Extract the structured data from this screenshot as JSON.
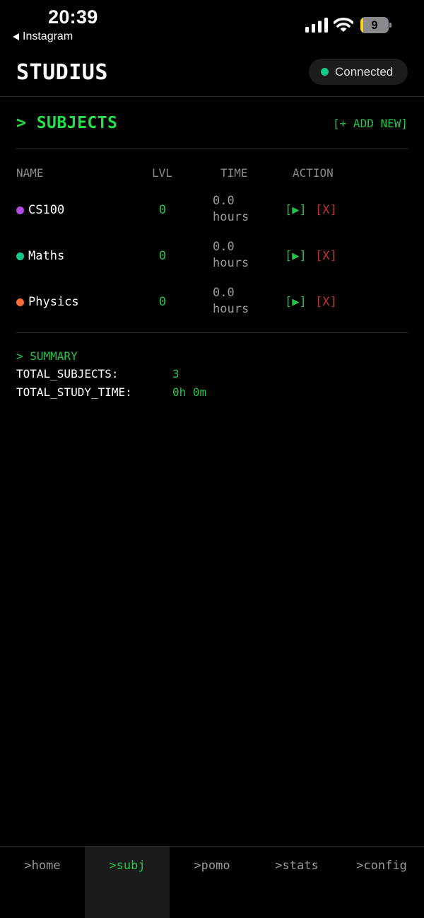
{
  "status_bar": {
    "time": "20:39",
    "back_label": "Instagram",
    "battery_level": "9",
    "battery_percent": 9
  },
  "header": {
    "title": "STUDIUS",
    "connection_label": "Connected",
    "connection_color": "#12c985"
  },
  "section": {
    "title": "> SUBJECTS",
    "add_new_label": "[+ ADD NEW]"
  },
  "table": {
    "columns": [
      "NAME",
      "LVL",
      "TIME",
      "ACTION"
    ],
    "rows": [
      {
        "name": "CS100",
        "color": "#b44be6",
        "level": "0",
        "time_value": "0.0",
        "time_unit": "hours",
        "play_label": "[▶]",
        "delete_label": "[X]"
      },
      {
        "name": "Maths",
        "color": "#12c985",
        "level": "0",
        "time_value": "0.0",
        "time_unit": "hours",
        "play_label": "[▶]",
        "delete_label": "[X]"
      },
      {
        "name": "Physics",
        "color": "#ff6a33",
        "level": "0",
        "time_value": "0.0",
        "time_unit": "hours",
        "play_label": "[▶]",
        "delete_label": "[X]"
      }
    ]
  },
  "summary": {
    "title": "> SUMMARY",
    "items": [
      {
        "label": "TOTAL_SUBJECTS:",
        "value": "3"
      },
      {
        "label": "TOTAL_STUDY_TIME:",
        "value": "0h 0m"
      }
    ]
  },
  "nav": {
    "items": [
      {
        "label": ">home",
        "active": false
      },
      {
        "label": ">subj",
        "active": true
      },
      {
        "label": ">pomo",
        "active": false
      },
      {
        "label": ">stats",
        "active": false
      },
      {
        "label": ">config",
        "active": false
      }
    ]
  },
  "colors": {
    "accent_green": "#22c44a",
    "danger_red": "#b8322e",
    "background": "#000000"
  }
}
